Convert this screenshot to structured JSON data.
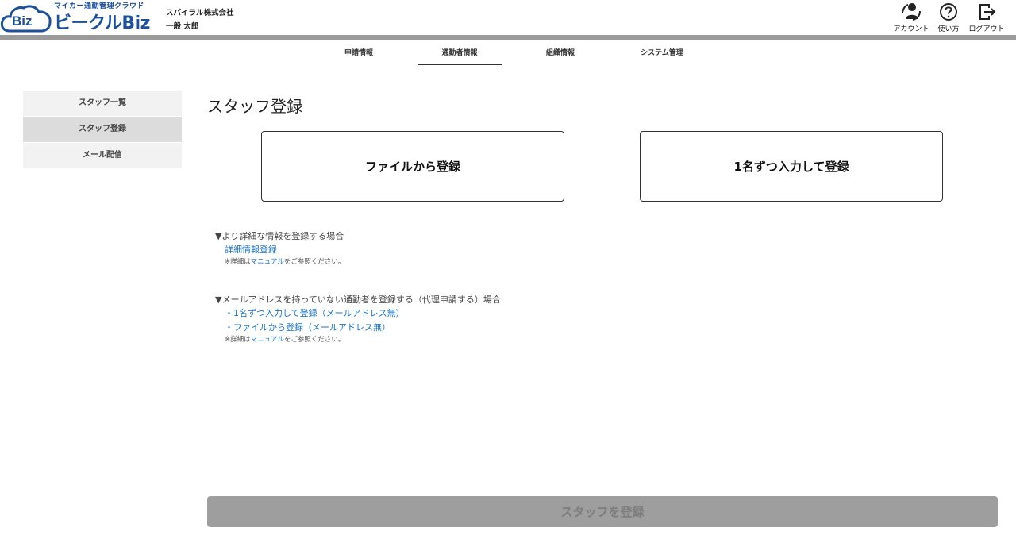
{
  "header": {
    "logo_text": "Biz",
    "logo_tagline": "マイカー通勤管理クラウド",
    "logo_name": "ビークルBiz",
    "company": "スパイラル株式会社",
    "user": "一般 太郎",
    "actions": [
      {
        "label": "アカウント",
        "icon": "account-icon"
      },
      {
        "label": "使い方",
        "icon": "help-icon"
      },
      {
        "label": "ログアウト",
        "icon": "logout-icon"
      }
    ]
  },
  "topnav": {
    "tabs": [
      {
        "label": "申請情報",
        "active": false
      },
      {
        "label": "通勤者情報",
        "active": true
      },
      {
        "label": "組織情報",
        "active": false
      },
      {
        "label": "システム管理",
        "active": false
      }
    ]
  },
  "sidebar": {
    "items": [
      {
        "label": "スタッフ一覧",
        "active": false
      },
      {
        "label": "スタッフ登録",
        "active": true
      },
      {
        "label": "メール配信",
        "active": false
      }
    ]
  },
  "main": {
    "title": "スタッフ登録",
    "file_button": "ファイルから登録",
    "manual_button": "1名ずつ入力して登録",
    "section1": {
      "heading": "▼より詳細な情報を登録する場合",
      "link": "詳細情報登録",
      "note_prefix": "※詳細は",
      "note_link": "マニュアル",
      "note_suffix": "をご参照ください。"
    },
    "section2": {
      "heading": "▼メールアドレスを持っていない通勤者を登録する（代理申請する）場合",
      "link1": "・1名ずつ入力して登録（メールアドレス無）",
      "link2": "・ファイルから登録（メールアドレス無）",
      "note_prefix": "※詳細は",
      "note_link": "マニュアル",
      "note_suffix": "をご参照ください。"
    },
    "submit_button": "スタッフを登録"
  },
  "colors": {
    "brand": "#1d4f9c",
    "link": "#1a73c8",
    "header_bar": "#9b9b9b",
    "submit_disabled": "#9e9e9e"
  }
}
